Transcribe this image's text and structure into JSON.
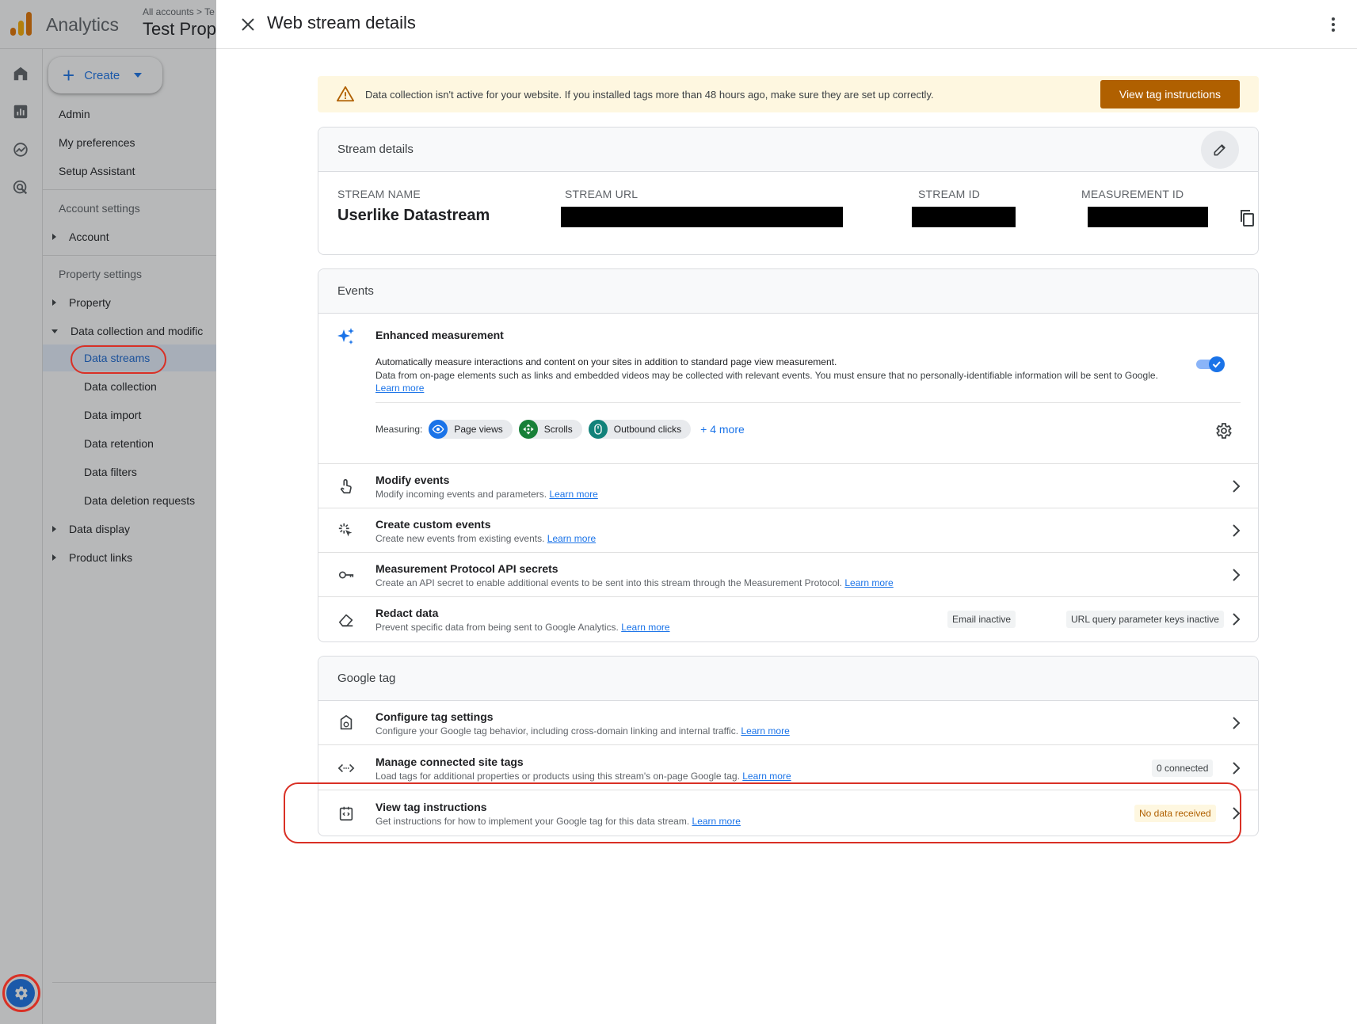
{
  "app": {
    "name": "Analytics",
    "account_path": "All accounts > Te",
    "property_name": "Test Prop"
  },
  "rail": {
    "icons": [
      "home-icon",
      "reports-icon",
      "explore-icon",
      "advertising-icon"
    ],
    "settings_icon": "gear-icon"
  },
  "sidebar": {
    "create_label": "Create",
    "items": {
      "admin": "Admin",
      "my_preferences": "My preferences",
      "setup_assistant": "Setup Assistant",
      "account_settings": "Account settings",
      "account": "Account",
      "property_settings": "Property settings",
      "property": "Property",
      "data_collection_and_modification": "Data collection and modific",
      "data_streams": "Data streams",
      "data_collection": "Data collection",
      "data_import": "Data import",
      "data_retention": "Data retention",
      "data_filters": "Data filters",
      "data_deletion_requests": "Data deletion requests",
      "data_display": "Data display",
      "product_links": "Product links"
    }
  },
  "panel": {
    "title": "Web stream details",
    "banner": {
      "text": "Data collection isn't active for your website. If you installed tags more than 48 hours ago, make sure they are set up correctly.",
      "button": "View tag instructions"
    },
    "stream_details": {
      "heading": "Stream details",
      "stream_name_label": "STREAM NAME",
      "stream_name": "Userlike Datastream",
      "stream_url_label": "STREAM URL",
      "stream_id_label": "STREAM ID",
      "measurement_id_label": "MEASUREMENT ID"
    },
    "events": {
      "heading": "Events",
      "enhanced": {
        "title": "Enhanced measurement",
        "desc1": "Automatically measure interactions and content on your sites in addition to standard page view measurement.",
        "desc2": "Data from on-page elements such as links and embedded videos may be collected with relevant events. You must ensure that no personally-identifiable information will be sent to Google.",
        "learn_more": "Learn more",
        "enabled": true,
        "measuring_label": "Measuring:",
        "chips": [
          "Page views",
          "Scrolls",
          "Outbound clicks"
        ],
        "more": "+ 4 more"
      },
      "rows": [
        {
          "title": "Modify events",
          "desc": "Modify incoming events and parameters.",
          "link": "Learn more"
        },
        {
          "title": "Create custom events",
          "desc": "Create new events from existing events.",
          "link": "Learn more"
        },
        {
          "title": "Measurement Protocol API secrets",
          "desc": "Create an API secret to enable additional events to be sent into this stream through the Measurement Protocol.",
          "link": "Learn more"
        },
        {
          "title": "Redact data",
          "desc": "Prevent specific data from being sent to Google Analytics.",
          "link": "Learn more",
          "badges": [
            "Email inactive",
            "URL query parameter keys inactive"
          ]
        }
      ]
    },
    "google_tag": {
      "heading": "Google tag",
      "rows": [
        {
          "title": "Configure tag settings",
          "desc": "Configure your Google tag behavior, including cross-domain linking and internal traffic.",
          "link": "Learn more"
        },
        {
          "title": "Manage connected site tags",
          "desc": "Load tags for additional properties or products using this stream's on-page Google tag.",
          "link": "Learn more",
          "badge": "0 connected"
        },
        {
          "title": "View tag instructions",
          "desc": "Get instructions for how to implement your Google tag for this data stream.",
          "link": "Learn more",
          "badge": "No data received"
        }
      ]
    }
  },
  "colors": {
    "accent": "#1a73e8",
    "warning": "#b06000",
    "banner_bg": "#fef7e0",
    "annotation": "#d93025"
  }
}
